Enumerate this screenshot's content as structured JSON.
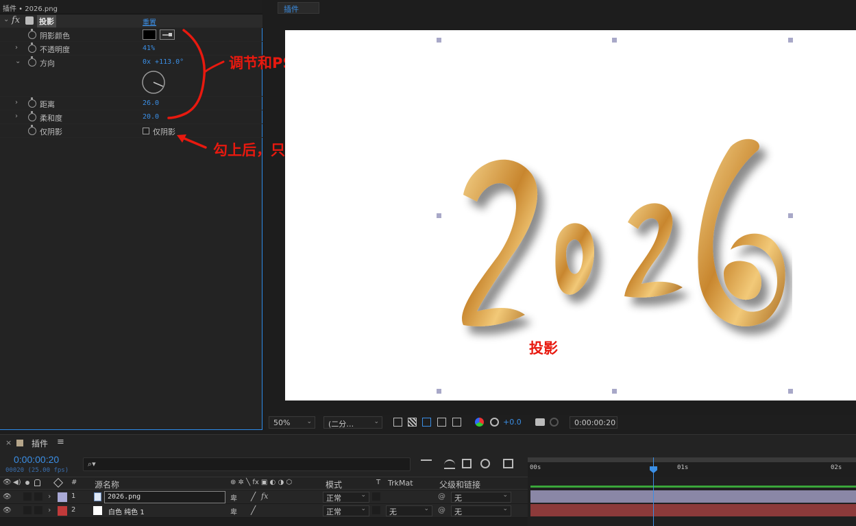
{
  "effect_panel": {
    "tab_title": "插件 • 2026.png",
    "effect": {
      "fx_label": "fx",
      "name": "投影",
      "reset_label": "重置"
    },
    "properties": [
      {
        "label": "阴影颜色"
      },
      {
        "label": "不透明度",
        "value": "41%"
      },
      {
        "label": "方向",
        "value": "0x +113.0°"
      },
      {
        "label": "距离",
        "value": "26.0"
      },
      {
        "label": "柔和度",
        "value": "20.0"
      },
      {
        "label": "仅阴影",
        "checkbox_label": "仅阴影",
        "checked": false
      }
    ],
    "shadow_color": "#000000",
    "direction_degrees": 113.0
  },
  "annotations": {
    "adjust_note": "调节和PS的一样",
    "shadow_only_note": "勾上后，只会显示阴影",
    "shadow_label": "投影"
  },
  "viewer": {
    "tab": "插件",
    "canvas_art_text": "2026",
    "toolbar": {
      "zoom": "50%",
      "resolution": "(二分…",
      "exposure": "+0.0",
      "timecode": "0:00:00:20"
    }
  },
  "timeline": {
    "tab": "插件",
    "timecode": "0:00:00:20",
    "frame_info": "00020 (25.00 fps)",
    "search_placeholder": "",
    "columns": {
      "index": "#",
      "source_name": "源名称",
      "mode": "模式",
      "t": "T",
      "trkmat": "TrkMat",
      "parent": "父级和链接"
    },
    "ruler_labels": [
      "00s",
      "01s",
      "02s"
    ],
    "layers": [
      {
        "index": "1",
        "name": "2026.png",
        "mode": "正常",
        "trkmat": "",
        "parent": "无",
        "color": "#a9a9d6",
        "fx": "fx"
      },
      {
        "index": "2",
        "name": "白色 纯色 1",
        "mode": "正常",
        "trkmat": "无",
        "parent": "无",
        "color": "#c03a3a"
      }
    ]
  },
  "colors": {
    "accent_blue": "#3b8fe6",
    "annotation_red": "#e8190f",
    "gold": "#d9a14a"
  }
}
